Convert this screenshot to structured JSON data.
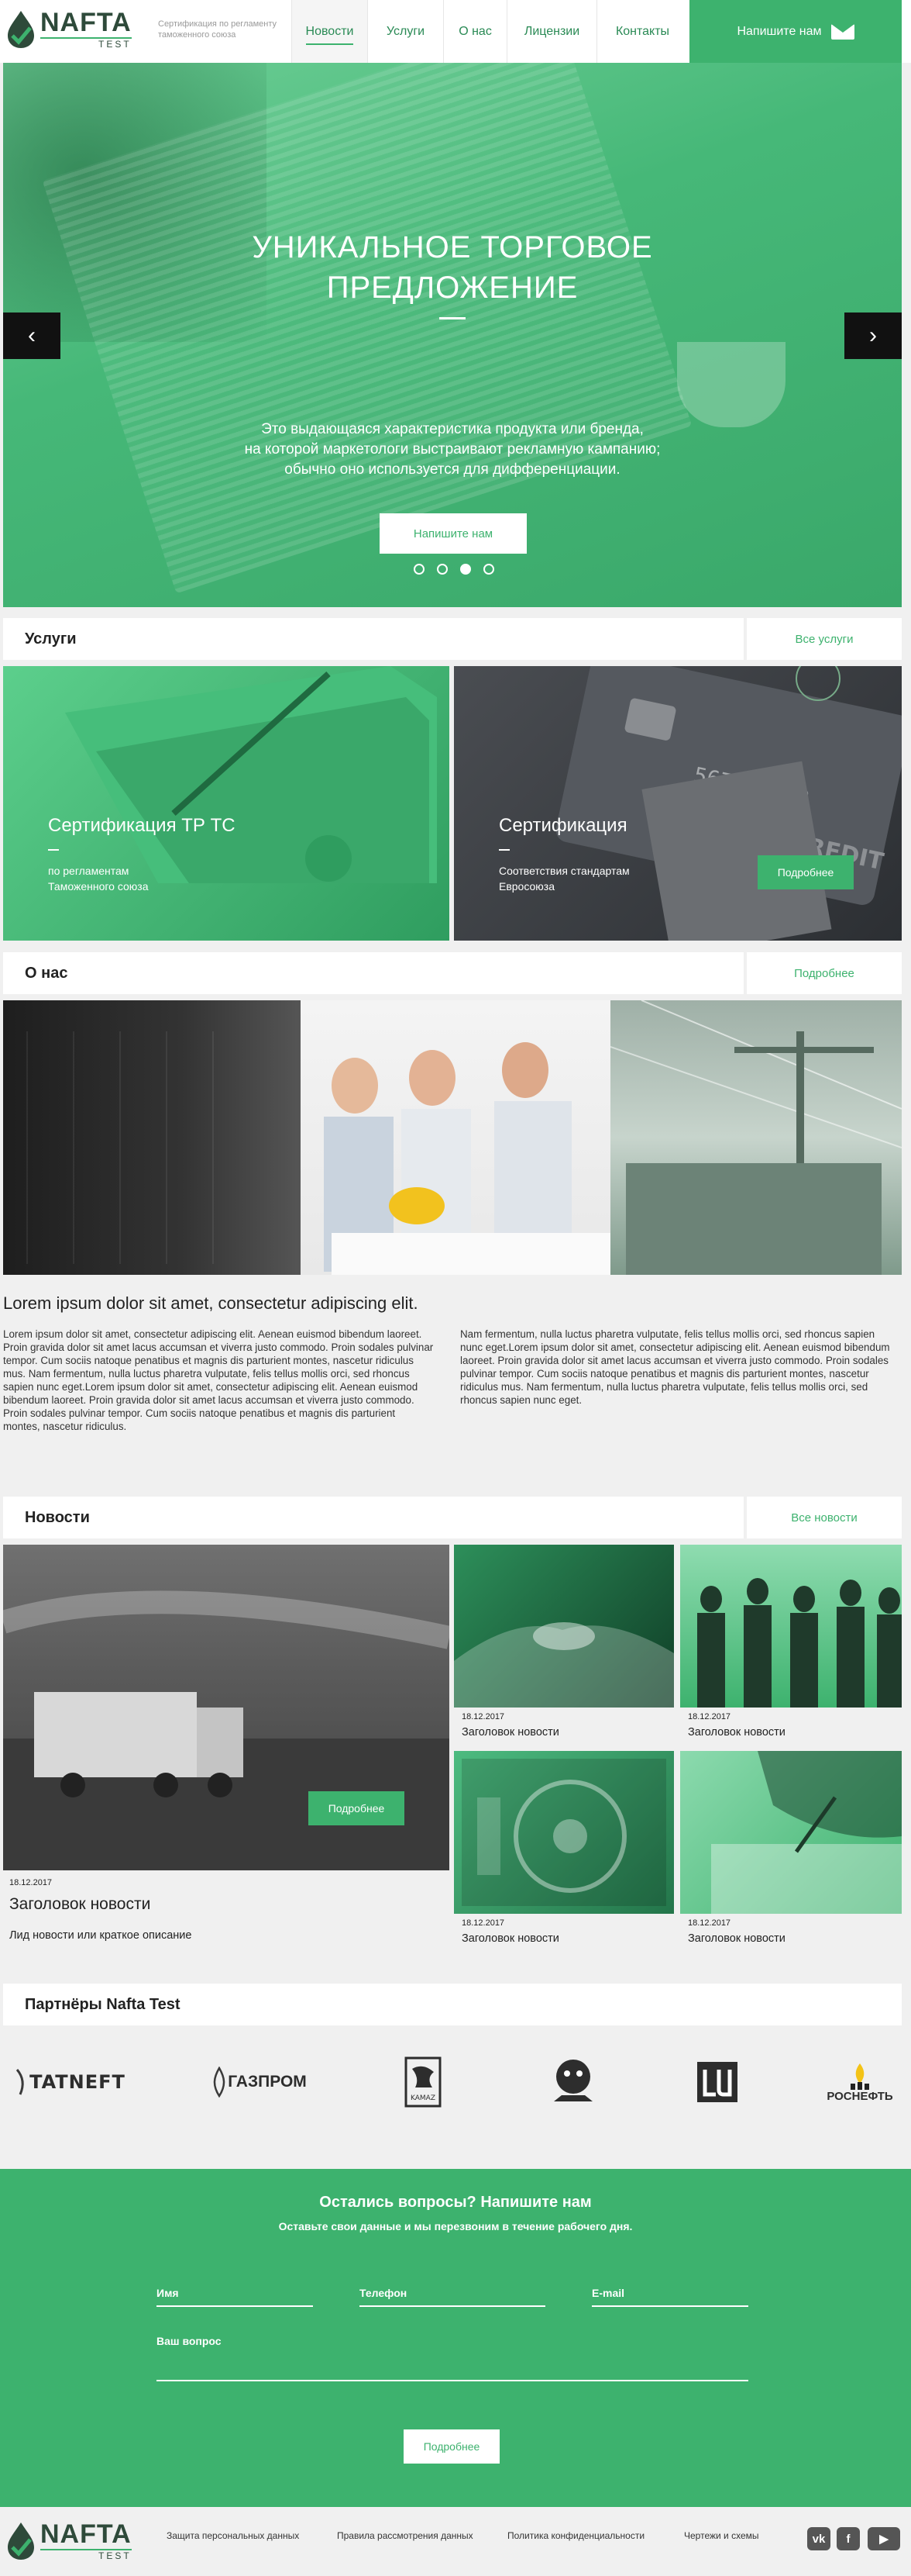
{
  "header": {
    "logo_text": "NAFTA",
    "logo_sub": "TEST",
    "tagline": "Сертификация по регламенту таможенного союза",
    "nav": [
      {
        "label": "Новости",
        "active": true
      },
      {
        "label": "Услуги",
        "active": false
      },
      {
        "label": "О нас",
        "active": false
      },
      {
        "label": "Лицензии",
        "active": false
      },
      {
        "label": "Контакты",
        "active": false
      }
    ],
    "cta_label": "Напишите нам"
  },
  "hero": {
    "title_line1": "УНИКАЛЬНОЕ ТОРГОВОЕ",
    "title_line2": "ПРЕДЛОЖЕНИЕ",
    "text_line1": "Это выдающаяся характеристика продукта или бренда,",
    "text_line2": "на которой маркетологи выстраивают рекламную кампанию;",
    "text_line3": "обычно оно используется для дифференциации.",
    "button": "Напишите нам",
    "prev": "‹",
    "next": "›",
    "slides_total": 4,
    "slide_active": 3
  },
  "services": {
    "title": "Услуги",
    "all_link": "Все услуги",
    "items": [
      {
        "title": "Сертификация ТР ТС",
        "sub1": "по регламентам",
        "sub2": "Таможенного союза"
      },
      {
        "title": "Сертификация",
        "sub1": "Соответствия стандартам",
        "sub2": "Евросоюза",
        "button": "Подробнее"
      }
    ]
  },
  "about": {
    "title": "О нас",
    "more_link": "Подробнее",
    "heading": "Lorem ipsum dolor sit amet, consectetur adipiscing elit.",
    "col1": "Lorem ipsum dolor sit amet, consectetur adipiscing elit. Aenean euismod bibendum laoreet. Proin gravida dolor sit amet lacus accumsan et viverra justo commodo. Proin sodales pulvinar tempor. Cum sociis natoque penatibus et magnis dis parturient montes, nascetur ridiculus mus. Nam fermentum, nulla luctus pharetra vulputate, felis tellus mollis orci, sed rhoncus sapien nunc eget.Lorem ipsum dolor sit amet, consectetur adipiscing elit. Aenean euismod bibendum laoreet. Proin gravida dolor sit amet lacus accumsan et viverra justo commodo. Proin sodales pulvinar tempor. Cum sociis natoque penatibus et magnis dis parturient montes, nascetur ridiculus.",
    "col2": "Nam fermentum, nulla luctus pharetra vulputate, felis tellus mollis orci, sed rhoncus sapien nunc eget.Lorem ipsum dolor sit amet, consectetur adipiscing elit. Aenean euismod bibendum laoreet. Proin gravida dolor sit amet lacus accumsan et viverra justo commodo. Proin sodales pulvinar tempor. Cum sociis natoque penatibus et magnis dis parturient montes, nascetur ridiculus mus. Nam fermentum, nulla luctus pharetra vulputate, felis tellus mollis orci, sed rhoncus sapien nunc eget."
  },
  "news": {
    "title": "Новости",
    "all_link": "Все новости",
    "featured": {
      "date": "18.12.2017",
      "title": "Заголовок новости",
      "lead": "Лид новости или краткое описание",
      "button": "Подробнее"
    },
    "items": [
      {
        "date": "18.12.2017",
        "title": "Заголовок новости"
      },
      {
        "date": "18.12.2017",
        "title": "Заголовок новости"
      },
      {
        "date": "18.12.2017",
        "title": "Заголовок новости"
      },
      {
        "date": "18.12.2017",
        "title": "Заголовок новости"
      }
    ]
  },
  "partners": {
    "title": "Партнёры Nafta Test",
    "logos": [
      "TATNEFT",
      "ГАЗПРОМ",
      "KAMAZ",
      "",
      "",
      "РОСНЕФТЬ"
    ]
  },
  "contact": {
    "title": "Остались вопросы? Напишите нам",
    "subtitle": "Оставьте свои данные и мы перезвоним в течение рабочего дня.",
    "name_label": "Имя",
    "phone_label": "Телефон",
    "email_label": "E-mail",
    "question_label": "Ваш вопрос",
    "button": "Подробнее"
  },
  "footer": {
    "logo_text": "NAFTA",
    "logo_sub": "TEST",
    "links": [
      "Защита персональных данных",
      "Правила рассмотрения данных",
      "Политика конфиденциальности",
      "Чертежи и схемы"
    ],
    "social": [
      "vk-icon",
      "facebook-icon",
      "youtube-icon"
    ]
  },
  "colors": {
    "accent": "#3db26e",
    "dark": "#2e4a3a"
  }
}
